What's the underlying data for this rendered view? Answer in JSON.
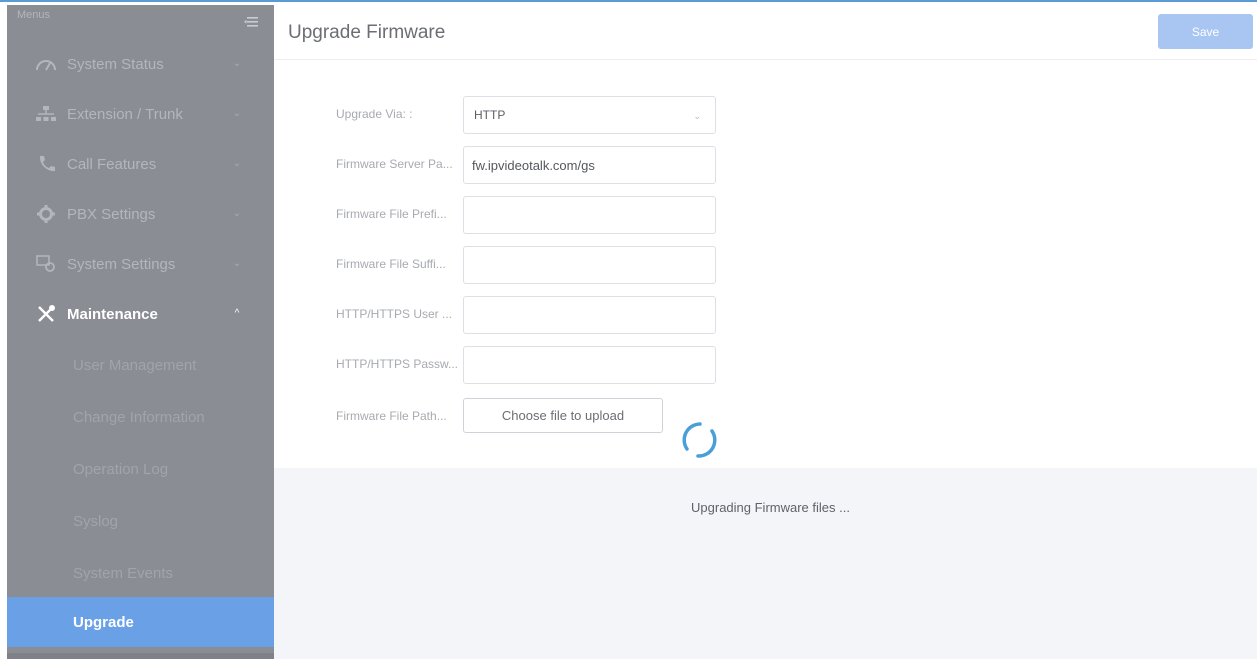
{
  "sidebar": {
    "menus_label": "Menus",
    "items": [
      {
        "label": "System Status",
        "icon": "gauge-icon"
      },
      {
        "label": "Extension / Trunk",
        "icon": "network-icon"
      },
      {
        "label": "Call Features",
        "icon": "phone-icon"
      },
      {
        "label": "PBX Settings",
        "icon": "gear-icon"
      },
      {
        "label": "System Settings",
        "icon": "settings-screen-icon"
      },
      {
        "label": "Maintenance",
        "icon": "tools-icon"
      }
    ],
    "maintenance_sub": [
      {
        "label": "User Management"
      },
      {
        "label": "Change Information"
      },
      {
        "label": "Operation Log"
      },
      {
        "label": "Syslog"
      },
      {
        "label": "System Events"
      },
      {
        "label": "Upgrade"
      }
    ],
    "selected_color": "#6aa0e6"
  },
  "header": {
    "title": "Upgrade Firmware",
    "save_label": "Save"
  },
  "form": {
    "upgrade_via_label": "Upgrade Via: :",
    "upgrade_via_value": "HTTP",
    "server_path_label": "Firmware Server Pa...",
    "server_path_value": "fw.ipvideotalk.com/gs",
    "file_prefix_label": "Firmware File Prefi...",
    "file_prefix_value": "",
    "file_suffix_label": "Firmware File Suffi...",
    "file_suffix_value": "",
    "http_user_label": "HTTP/HTTPS User ...",
    "http_user_value": "",
    "http_pass_label": "HTTP/HTTPS Passw...",
    "http_pass_value": "",
    "file_path_label": "Firmware File Path...",
    "upload_label": "Choose file to upload"
  },
  "status": {
    "message": "Upgrading Firmware files ..."
  }
}
